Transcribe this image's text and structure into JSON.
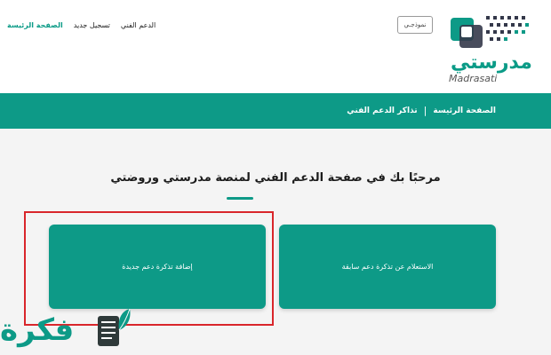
{
  "header": {
    "nav": {
      "home": "الصفحة الرئيسة",
      "new_registration": "تسجيل جديد",
      "tech_support": "الدعم الفني"
    },
    "model_badge": "نموذجـي",
    "logo": {
      "brand_ar": "مدرستي",
      "brand_en": "Madrasati"
    }
  },
  "breadcrumb": {
    "home": "الصفحة الرئيسة",
    "separator": "|",
    "current": "تذاكر الدعم الفني"
  },
  "main": {
    "welcome": "مرحبًا بك في صفحة الدعم الفني لمنصة مدرستي وروضتي",
    "cards": {
      "add_ticket": "إضافة تذكرة دعم جديدة",
      "inquiry_ticket": "الاستعلام عن تذكرة دعم سابقة"
    }
  },
  "watermark": {
    "text": "فكرة"
  },
  "colors": {
    "brand_green": "#0d9a87",
    "highlight_red": "#d9262b"
  }
}
